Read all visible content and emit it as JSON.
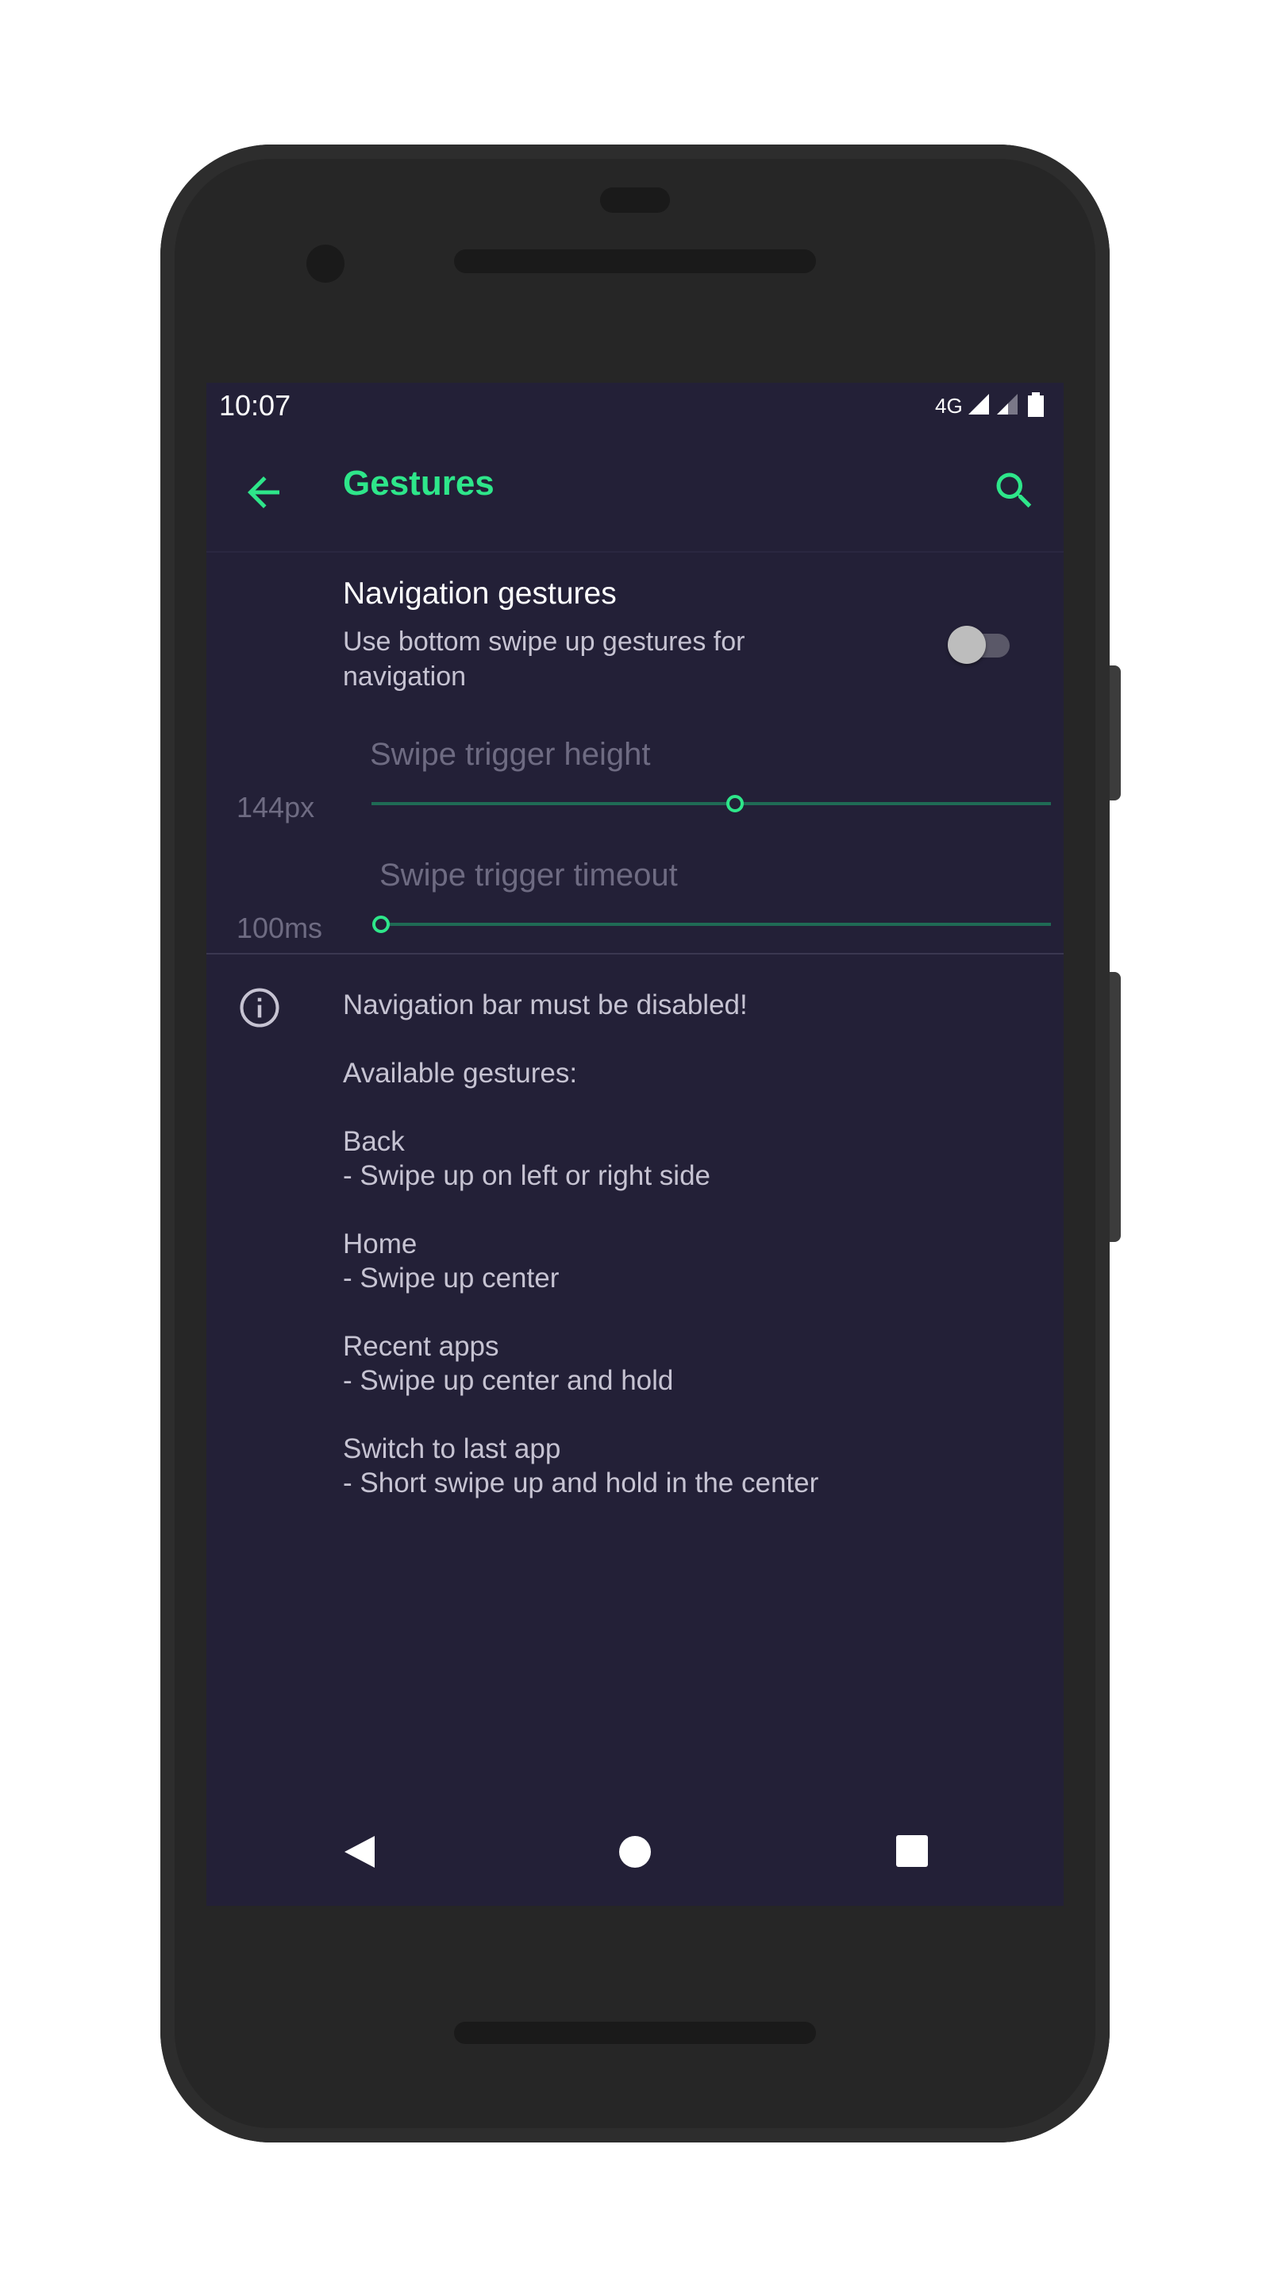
{
  "status_bar": {
    "time": "10:07",
    "network": "4G"
  },
  "app_bar": {
    "title": "Gestures",
    "back_icon": "arrow-back-icon",
    "search_icon": "search-icon"
  },
  "navigation_gestures": {
    "title": "Navigation gestures",
    "summary": "Use bottom swipe up gestures for navigation",
    "enabled": false
  },
  "sliders": [
    {
      "value_text": "144px",
      "label": "Swipe trigger height",
      "position": 0.5
    },
    {
      "value_text": "100ms",
      "label": "Swipe trigger timeout",
      "position": 0.0
    }
  ],
  "info": {
    "icon": "info-icon",
    "warning": "Navigation bar must be disabled!",
    "available": "Available gestures:",
    "gestures": [
      {
        "name": "Back",
        "description": "- Swipe up on left or right side"
      },
      {
        "name": "Home",
        "description": "- Swipe up center"
      },
      {
        "name": "Recent apps",
        "description": "- Swipe up center and hold"
      },
      {
        "name": "Switch to last app",
        "description": "- Short swipe up and hold in the center"
      }
    ]
  },
  "colors": {
    "accent": "#2ee68a",
    "background": "#232037",
    "slider_track": "#1f6b55"
  }
}
